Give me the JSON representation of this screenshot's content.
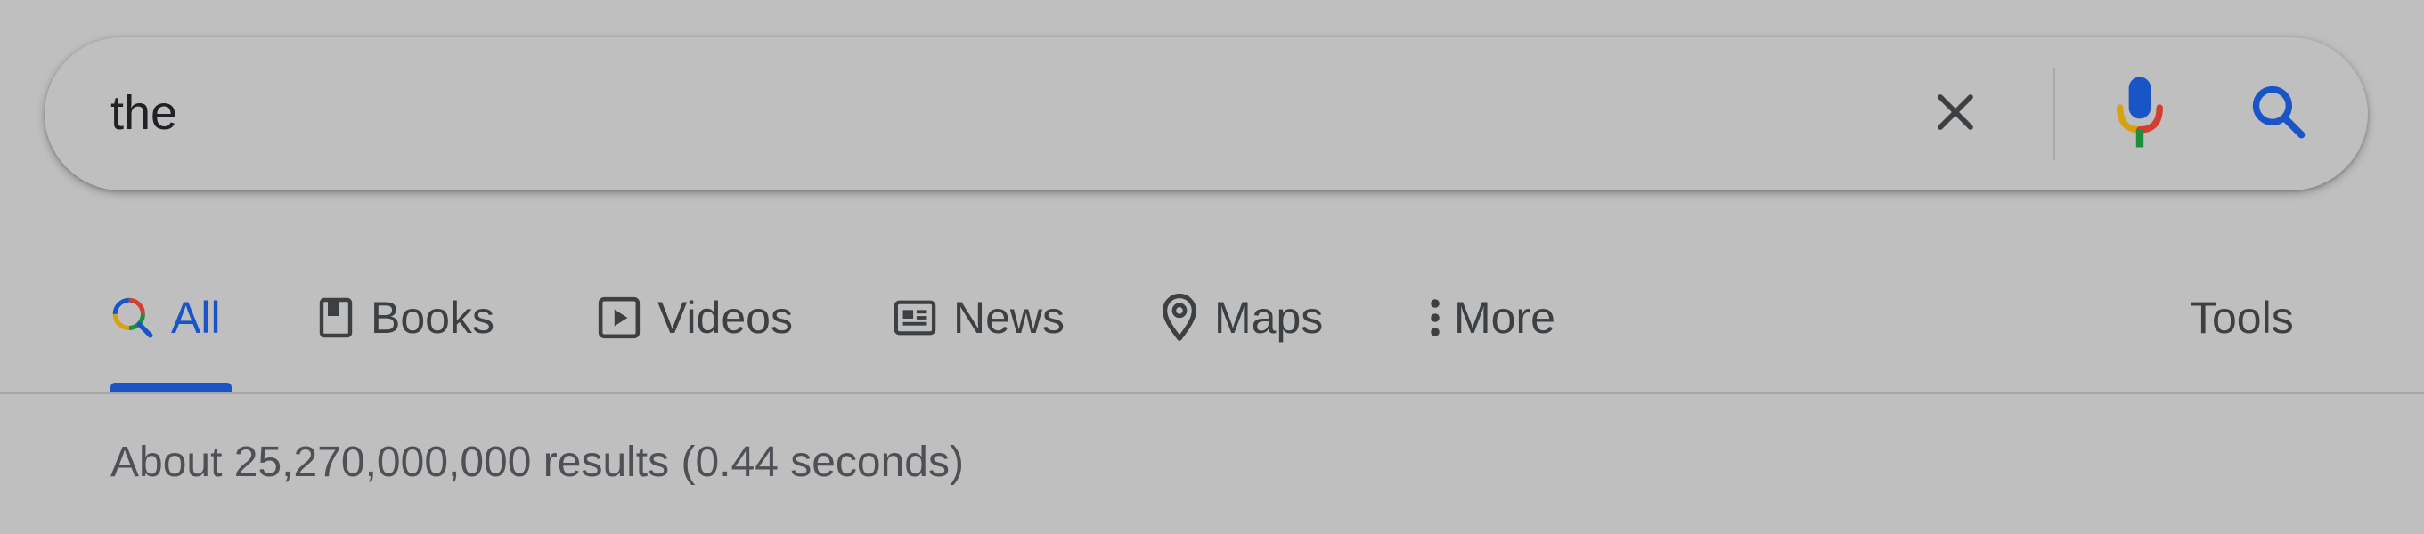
{
  "search": {
    "query": "the",
    "clear_icon": "close-icon",
    "mic_icon": "microphone-icon",
    "search_icon": "search-icon"
  },
  "tabs": [
    {
      "label": "All",
      "icon": "google-search-icon",
      "active": true
    },
    {
      "label": "Books",
      "icon": "book-icon"
    },
    {
      "label": "Videos",
      "icon": "play-icon"
    },
    {
      "label": "News",
      "icon": "newspaper-icon"
    },
    {
      "label": "Maps",
      "icon": "map-pin-icon"
    },
    {
      "label": "More",
      "icon": "more-vert-icon"
    }
  ],
  "tools_label": "Tools",
  "result_stats": "About 25,270,000,000 results (0.44 seconds)",
  "colors": {
    "background": "#bfbfbf",
    "active_tab": "#1a55c8",
    "text": "#3c4043",
    "mic_blue": "#1a55c8",
    "mic_red": "#d23f31",
    "mic_yellow": "#d9a10f",
    "mic_green": "#1e8e3e"
  }
}
